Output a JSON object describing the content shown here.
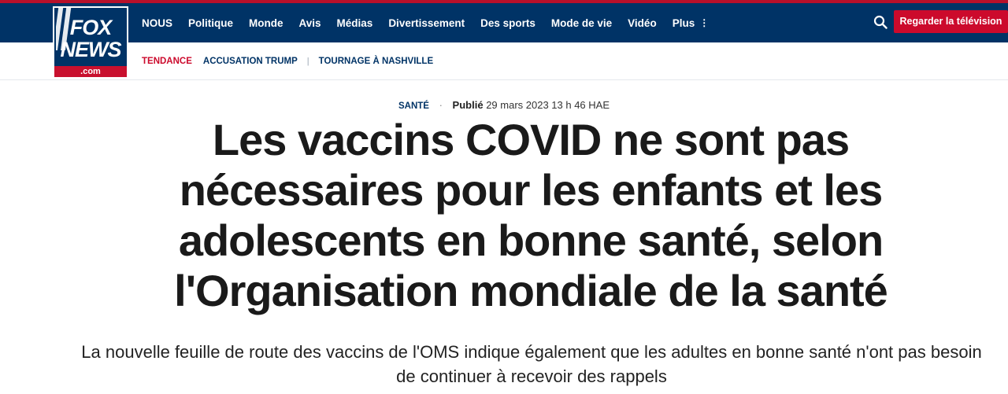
{
  "brand": {
    "logo_top": "FOX",
    "logo_bottom": "NEWS",
    "logo_domain": ".com",
    "colors": {
      "navy": "#003366",
      "red": "#cc0a2c"
    }
  },
  "nav": {
    "items": [
      "NOUS",
      "Politique",
      "Monde",
      "Avis",
      "Médias",
      "Divertissement",
      "Des sports",
      "Mode de vie",
      "Vidéo"
    ],
    "more_label": "Plus",
    "more_icon": "⋮",
    "search_icon": "search-icon",
    "watch_label": "Regarder la télévision"
  },
  "trending": {
    "label": "TENDANCE",
    "items": [
      "ACCUSATION TRUMP",
      "TOURNAGE À NASHVILLE"
    ]
  },
  "article": {
    "section": "SANTÉ",
    "published_label": "Publié",
    "published_date": "29 mars 2023 13 h 46 HAE",
    "headline": "Les vaccins COVID ne sont pas nécessaires pour les enfants et les adolescents en bonne santé, selon l'Organisation mondiale de la santé",
    "dek": "La nouvelle feuille de route des vaccins de l'OMS indique également que les adultes en bonne santé n'ont pas besoin de continuer à recevoir des rappels"
  }
}
